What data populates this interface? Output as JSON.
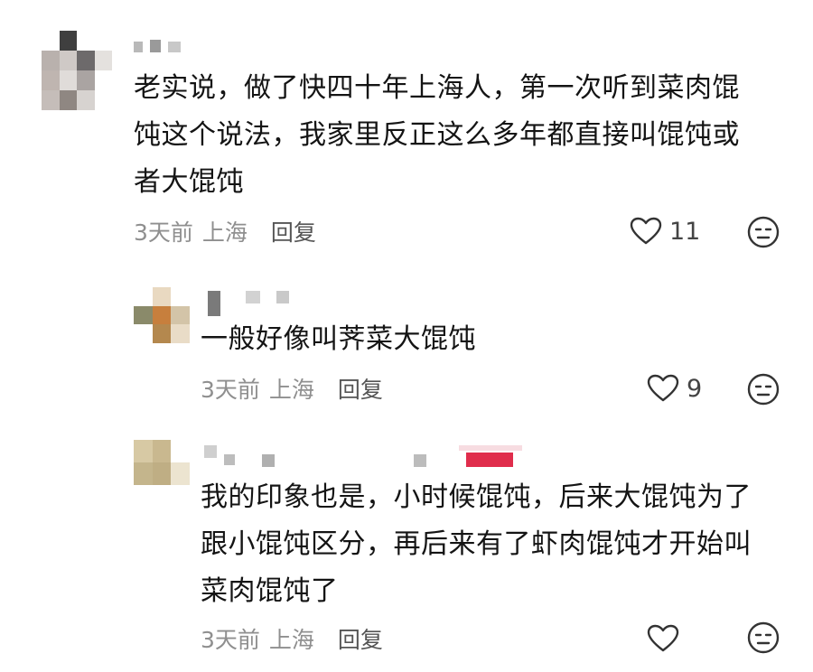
{
  "comments": [
    {
      "text_lines": [
        "老实说，做了快四十年上海人，第一次听到菜肉馄",
        "饨这个说法，我家里反正这么多年都直接叫馄饨或",
        "者大馄饨"
      ],
      "time": "3天前",
      "location": "上海",
      "reply_label": "回复",
      "likes": "11"
    },
    {
      "text_lines": [
        "一般好像叫荠菜大馄饨"
      ],
      "time": "3天前",
      "location": "上海",
      "reply_label": "回复",
      "likes": "9"
    },
    {
      "text_lines": [
        "我的印象也是，小时候馄饨，后来大馄饨为了",
        "跟小馄饨区分，再后来有了虾肉馄饨才开始叫",
        "菜肉馄饨了"
      ],
      "time": "3天前",
      "location": "上海",
      "reply_label": "回复",
      "likes": ""
    }
  ],
  "icons": {
    "like": "heart-outline-icon",
    "dislike": "meh-face-icon"
  },
  "colors": {
    "text": "#141414",
    "meta": "#8f8f8f",
    "reply": "#555555",
    "icon": "#333333"
  }
}
